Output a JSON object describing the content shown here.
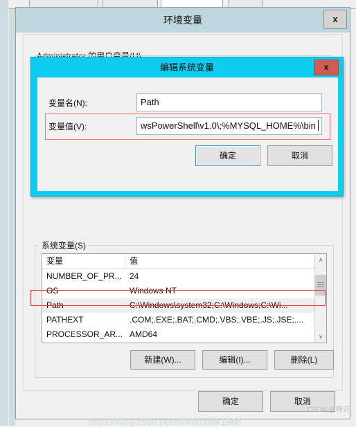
{
  "background": {
    "tabs": [
      {
        "label": "",
        "active": false
      },
      {
        "label": "",
        "active": false
      },
      {
        "label": "",
        "active": true
      },
      {
        "label": "",
        "active": false
      }
    ]
  },
  "env_dialog": {
    "title": "环境变量",
    "close_label": "x",
    "user_group": {
      "label": "Administrator 的用户变量(U)"
    },
    "system_group": {
      "label": "系统变量(S)",
      "columns": [
        "变量",
        "值"
      ],
      "rows": [
        {
          "name": "NUMBER_OF_PR...",
          "value": "24",
          "selected": false
        },
        {
          "name": "OS",
          "value": "Windows NT",
          "selected": false
        },
        {
          "name": "Path",
          "value": "C:\\Windows\\system32;C:\\Windows;C:\\Wi...",
          "selected": true
        },
        {
          "name": "PATHEXT",
          "value": ".COM;.EXE;.BAT;.CMD;.VBS;.VBE;.JS;.JSE;....",
          "selected": false
        },
        {
          "name": "PROCESSOR_AR...",
          "value": "AMD64",
          "selected": false
        }
      ],
      "scrollbar": {
        "up_arrow": "∧",
        "down_arrow": "∨"
      },
      "buttons": {
        "new": "新建(W)...",
        "edit": "编辑(I)...",
        "delete": "删除(L)"
      }
    },
    "footer": {
      "ok": "确定",
      "cancel": "取消"
    }
  },
  "edit_dialog": {
    "title": "编辑系统变量",
    "close_label": "x",
    "fields": {
      "name_label": "变量名(N):",
      "name_value": "Path",
      "value_label": "变量值(V):",
      "value_value": "wsPowerShell\\v1.0\\;%MYSQL_HOME%\\bin"
    },
    "footer": {
      "ok": "确定",
      "cancel": "取消"
    }
  },
  "watermark": {
    "url": "https://blog.csdn.net/milkbrother1988",
    "author": "CSDN @梓沂"
  },
  "colors": {
    "edit_dialog_titlebar": "#0ccdee",
    "edit_close_button": "#cd5d54",
    "env_titlebar": "#bed7de",
    "highlight_red": "#ef3b3b",
    "focus_blue": "#3d9ad1"
  }
}
